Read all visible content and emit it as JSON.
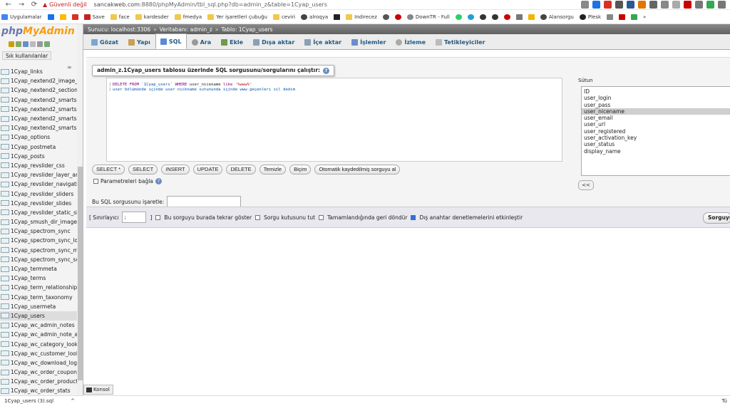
{
  "browser": {
    "security_label": "Güvenli değil",
    "url_host": "sancakweb.com",
    "url_rest": ":8880/phpMyAdmin/tbl_sql.php?db=admin_z&table=1Cyap_users",
    "bookmarks": [
      "Uygulamalar",
      "",
      "",
      "",
      "Save",
      "face",
      "kardesder",
      "fmedya",
      "Yer işaretleri çubuğu",
      "ceviri",
      "alroqya",
      "",
      "Indirecez",
      "",
      "",
      "DownTR - Full",
      "",
      "",
      "",
      "",
      "",
      "",
      "",
      "Alansorgu",
      "Plesk",
      "",
      "",
      "",
      "»"
    ],
    "download_file": "1Cyap_users (3).sql",
    "download_right": "Tü"
  },
  "pma": {
    "logo_php": "php",
    "logo_my": "MyAdmin",
    "recent_label": "Sık kullanılanlar",
    "tables": [
      "1Cyap_links",
      "1Cyap_nextend2_image_s",
      "1Cyap_nextend2_section_",
      "1Cyap_nextend2_smartsli",
      "1Cyap_nextend2_smartsli",
      "1Cyap_nextend2_smartsli",
      "1Cyap_nextend2_smartsli",
      "1Cyap_options",
      "1Cyap_postmeta",
      "1Cyap_posts",
      "1Cyap_revslider_css",
      "1Cyap_revslider_layer_ani",
      "1Cyap_revslider_navigatio",
      "1Cyap_revslider_sliders",
      "1Cyap_revslider_slides",
      "1Cyap_revslider_static_sli",
      "1Cyap_smush_dir_images",
      "1Cyap_spectrom_sync",
      "1Cyap_spectrom_sync_log",
      "1Cyap_spectrom_sync_me",
      "1Cyap_spectrom_sync_so",
      "1Cyap_termmeta",
      "1Cyap_terms",
      "1Cyap_term_relationships",
      "1Cyap_term_taxonomy",
      "1Cyap_usermeta",
      "1Cyap_users",
      "1Cyap_wc_admin_notes",
      "1Cyap_wc_admin_note_ac",
      "1Cyap_wc_category_looku",
      "1Cyap_wc_customer_look",
      "1Cyap_wc_download_log",
      "1Cyap_wc_order_coupon_",
      "1Cyap_wc_order_product_",
      "1Cyap_wc_order_stats"
    ],
    "breadcrumb": {
      "server": "Sunucu: localhost:3306",
      "database": "Veritabanı: admin_z",
      "table": "Tablo: 1Cyap_users"
    },
    "tabs": [
      "Gözat",
      "Yapı",
      "SQL",
      "Ara",
      "Ekle",
      "Dışa aktar",
      "İçe aktar",
      "İşlemler",
      "İzleme",
      "Tetikleyiciler"
    ],
    "legend": "admin_z.1Cyap_users tablosu üzerinde SQL sorgusunu/sorgularını çalıştır:",
    "sql_lines": {
      "line1_no": "1",
      "line1_kw1": "DELETE FROM ",
      "line1_table": "`1Cyap_users`",
      "line1_kw2": " WHERE ",
      "line1_col": "user_nicename",
      "line1_kw3": " like ",
      "line1_str": "'%www%'",
      "line2_no": "2",
      "line2_text": "user bölümünde içinde user nickname sutununda içinde www geçenleri sil dedim"
    },
    "columns_label": "Sütun",
    "columns": [
      "ID",
      "user_login",
      "user_pass",
      "user_nicename",
      "user_email",
      "user_url",
      "user_registered",
      "user_activation_key",
      "user_status",
      "display_name"
    ],
    "selected_column": "user_nicename",
    "insert_btn": "<<",
    "buttons": [
      "SELECT *",
      "SELECT",
      "INSERT",
      "UPDATE",
      "DELETE",
      "Temizle",
      "Biçim",
      "Otomatik kaydedilmiş sorguyu al"
    ],
    "bind_params_label": "Parametreleri bağla",
    "bookmark_label": "Bu SQL sorgusunu işaretle:",
    "delimiter_label": "[ Sınırlayıcı",
    "delimiter_value": ";",
    "delimiter_close": "]",
    "options": [
      {
        "label": "Bu sorguyu burada tekrar göster",
        "checked": false
      },
      {
        "label": "Sorgu kutusunu tut",
        "checked": false
      },
      {
        "label": "Tamamlandığında geri döndür",
        "checked": false
      },
      {
        "label": "Dış anahtar denetlemelerini etkinleştir",
        "checked": true
      }
    ],
    "go_label": "Sorguyu",
    "console_label": "Konsol"
  },
  "colors": {
    "tab_text": "#235a81",
    "logo_php": "#6c78af",
    "logo_my": "#f89c0e",
    "security": "#c5221f"
  }
}
